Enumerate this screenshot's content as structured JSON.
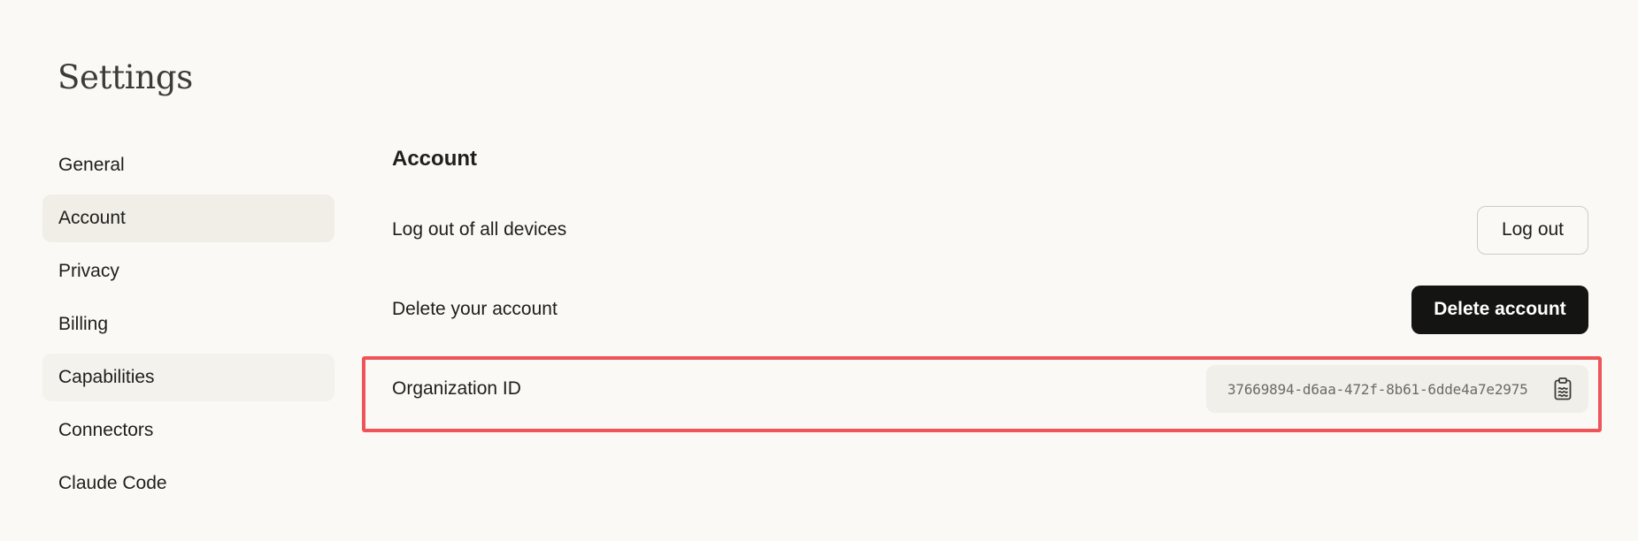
{
  "page": {
    "title": "Settings"
  },
  "sidebar": {
    "items": [
      {
        "label": "General"
      },
      {
        "label": "Account"
      },
      {
        "label": "Privacy"
      },
      {
        "label": "Billing"
      },
      {
        "label": "Capabilities"
      },
      {
        "label": "Connectors"
      },
      {
        "label": "Claude Code"
      }
    ],
    "active_item": "Account",
    "hovered_item": "Capabilities"
  },
  "account": {
    "section_title": "Account",
    "logout_all": {
      "label": "Log out of all devices",
      "button_label": "Log out"
    },
    "delete_account": {
      "label": "Delete your account",
      "button_label": "Delete account"
    },
    "organization": {
      "label": "Organization ID",
      "value": "37669894-d6aa-472f-8b61-6dde4a7e2975",
      "copy_icon": "clipboard-icon"
    }
  },
  "colors": {
    "background": "#faf9f5",
    "active_item_bg": "#f0eee6",
    "dark_button": "#141413",
    "highlight": "#ef5459"
  }
}
